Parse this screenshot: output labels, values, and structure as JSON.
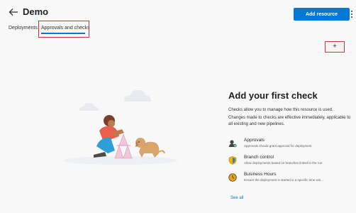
{
  "header": {
    "title": "Demo",
    "add_resource_label": "Add resource"
  },
  "tabs": [
    {
      "label": "Deployments"
    },
    {
      "label": "Approvals and checks"
    }
  ],
  "plus_button": {
    "label": "+"
  },
  "empty_state": {
    "title": "Add your first check",
    "description_1": "Checks allow you to manage how this resource is used.",
    "description_2": "Changes made to checks are effective immediately, applicable to all existing and new pipelines."
  },
  "checks": [
    {
      "name": "Approvals",
      "description": "Approvals should grant approval for deployment",
      "icon": "approval-icon"
    },
    {
      "name": "Branch control",
      "description": "Allow deployments based on branches linked to the run",
      "icon": "shield-icon"
    },
    {
      "name": "Business Hours",
      "description": "Ensure the deployment is started in a specific time win...",
      "icon": "clock-icon"
    }
  ],
  "see_all_label": "See all",
  "colors": {
    "accent": "#0078d4",
    "highlight_box": "#d13438"
  }
}
